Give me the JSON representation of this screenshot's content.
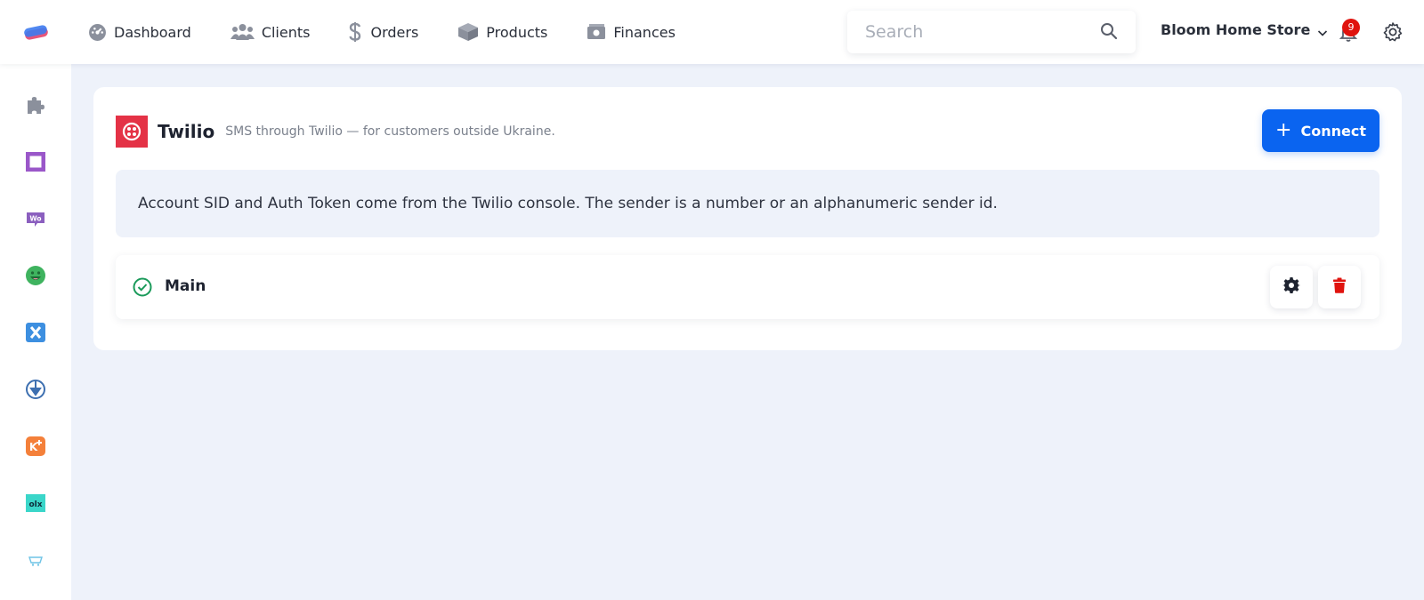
{
  "nav": {
    "items": [
      {
        "label": "Dashboard",
        "icon": "dashboard-icon"
      },
      {
        "label": "Clients",
        "icon": "users-icon"
      },
      {
        "label": "Orders",
        "icon": "dollar-icon"
      },
      {
        "label": "Products",
        "icon": "box-icon"
      },
      {
        "label": "Finances",
        "icon": "money-icon"
      }
    ]
  },
  "search": {
    "placeholder": "Search",
    "value": ""
  },
  "store": {
    "name": "Bloom Home Store"
  },
  "notifications": {
    "count": "9"
  },
  "sidebar": {
    "items": [
      {
        "icon": "puzzle-icon"
      },
      {
        "icon": "square-app-icon"
      },
      {
        "icon": "woocommerce-icon"
      },
      {
        "icon": "smiley-app-icon"
      },
      {
        "icon": "x-app-icon"
      },
      {
        "icon": "arrow-app-icon"
      },
      {
        "icon": "k-plus-app-icon"
      },
      {
        "icon": "olx-icon"
      },
      {
        "icon": "cart-icon"
      }
    ]
  },
  "integration": {
    "name": "Twilio",
    "description": "SMS through Twilio — for customers outside Ukraine.",
    "connect_label": "Connect",
    "note": "Account SID and Auth Token come from the Twilio console. The sender is a number or an alphanumeric sender id.",
    "accounts": [
      {
        "name": "Main",
        "status": "active"
      }
    ]
  },
  "colors": {
    "primary": "#0a64f0",
    "twilio": "#e43246",
    "success": "#1a9a5a",
    "danger": "#e0130e"
  }
}
